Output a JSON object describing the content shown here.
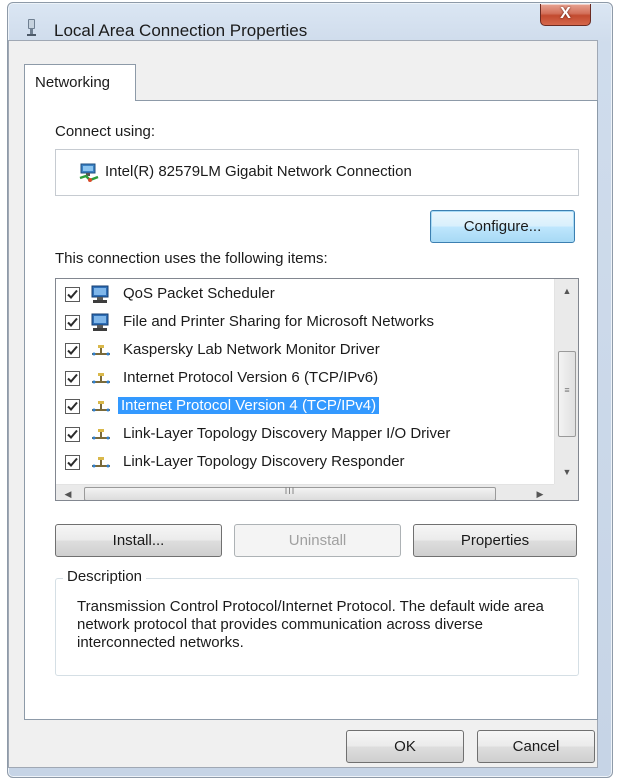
{
  "window": {
    "title": "Local Area Connection Properties",
    "close_label": "X"
  },
  "tabs": [
    {
      "label": "Networking"
    }
  ],
  "connect_using_label": "Connect using:",
  "adapter_name": "Intel(R) 82579LM Gigabit Network Connection",
  "configure_label": "Configure...",
  "items_label": "This connection uses the following items:",
  "items": [
    {
      "label": "QoS Packet Scheduler",
      "checked": true,
      "icon": "qos-computer-icon",
      "selected": false
    },
    {
      "label": "File and Printer Sharing for Microsoft Networks",
      "checked": true,
      "icon": "file-printer-sharing-icon",
      "selected": false
    },
    {
      "label": "Kaspersky Lab Network Monitor Driver",
      "checked": true,
      "icon": "network-protocol-icon",
      "selected": false
    },
    {
      "label": "Internet Protocol Version 6 (TCP/IPv6)",
      "checked": true,
      "icon": "network-protocol-icon",
      "selected": false
    },
    {
      "label": "Internet Protocol Version 4 (TCP/IPv4)",
      "checked": true,
      "icon": "network-protocol-icon",
      "selected": true
    },
    {
      "label": "Link-Layer Topology Discovery Mapper I/O Driver",
      "checked": true,
      "icon": "network-protocol-icon",
      "selected": false
    },
    {
      "label": "Link-Layer Topology Discovery Responder",
      "checked": true,
      "icon": "network-protocol-icon",
      "selected": false
    }
  ],
  "scrollbar": {
    "thumb_grip": "III",
    "vthumb_grip": "≡"
  },
  "buttons": {
    "install": "Install...",
    "uninstall": "Uninstall",
    "properties": "Properties",
    "ok": "OK",
    "cancel": "Cancel"
  },
  "description": {
    "label": "Description",
    "text": "Transmission Control Protocol/Internet Protocol. The default wide area network protocol that provides communication across diverse interconnected networks."
  },
  "colors": {
    "selection": "#3399ff",
    "close_button": "#c8533a",
    "window_frame": "#cfdcec"
  }
}
